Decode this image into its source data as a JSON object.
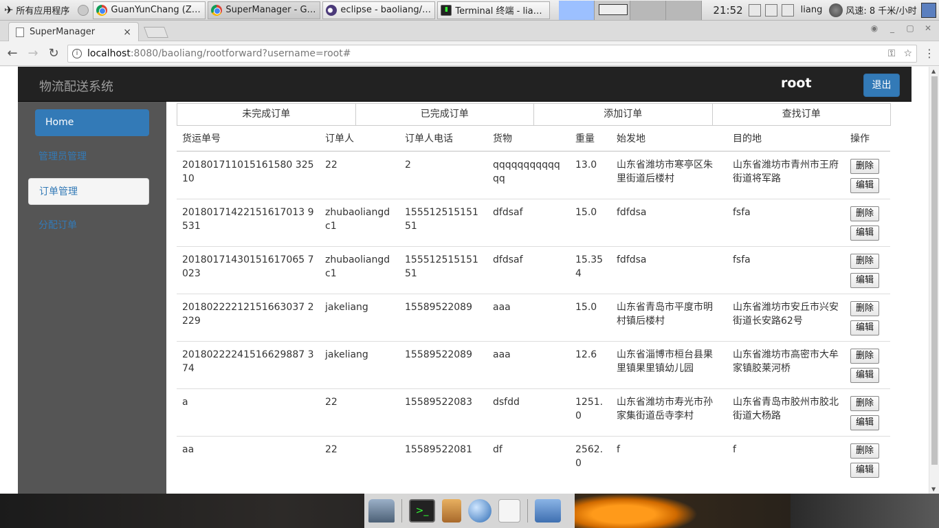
{
  "taskbar": {
    "apps_menu": "所有应用程序",
    "tasks": [
      {
        "icon": "chrome-icon",
        "label": "GuanYunChang (ZhuB…"
      },
      {
        "icon": "chrome-icon",
        "label": "SuperManager - Goog…"
      },
      {
        "icon": "eclipse-icon",
        "label": "eclipse - baoliang/src…"
      },
      {
        "icon": "terminal-icon",
        "label": "Terminal 终端 - liang…"
      }
    ],
    "clock": "21:52",
    "user": "liang",
    "weather": "风速: 8 千米/小时"
  },
  "browser": {
    "tab_title": "SuperManager",
    "tab_close": "×",
    "url_host": "localhost",
    "url_rest": ":8080/baoliang/rootforward?username=root#",
    "window_buttons": [
      "_",
      "▢",
      "✕"
    ]
  },
  "site": {
    "brand": "物流配送系统",
    "username": "root",
    "logout": "退出",
    "sidebar": [
      "Home",
      "管理员管理",
      "订单管理",
      "分配订单"
    ],
    "tabs": [
      "未完成订单",
      "已完成订单",
      "添加订单",
      "查找订单"
    ],
    "columns": [
      "货运单号",
      "订单人",
      "订单人电话",
      "货物",
      "重量",
      "始发地",
      "目的地",
      "操作"
    ],
    "delete_label": "删除",
    "edit_label": "编辑",
    "rows": [
      {
        "id": "201801711015161580 32510",
        "name": "22",
        "phone": "2",
        "goods": "qqqqqqqqqqqqq",
        "weight": "13.0",
        "from": "山东省潍坊市寒亭区朱里街道后楼村",
        "to": "山东省潍坊市青州市王府街道将军路"
      },
      {
        "id": "20180171422151617013 9531",
        "name": "zhubaoliangdc1",
        "phone": "15551251515151",
        "goods": "dfdsaf",
        "weight": "15.0",
        "from": "fdfdsa",
        "to": "fsfa"
      },
      {
        "id": "20180171430151617065 7023",
        "name": "zhubaoliangdc1",
        "phone": "15551251515151",
        "goods": "dfdsaf",
        "weight": "15.354",
        "from": "fdfdsa",
        "to": "fsfa"
      },
      {
        "id": "20180222212151663037 2229",
        "name": "jakeliang",
        "phone": "15589522089",
        "goods": "aaa",
        "weight": "15.0",
        "from": "山东省青岛市平度市明村镇后楼村",
        "to": "山东省潍坊市安丘市兴安街道长安路62号"
      },
      {
        "id": "20180222241516629887 374",
        "name": "jakeliang",
        "phone": "15589522089",
        "goods": "aaa",
        "weight": "12.6",
        "from": "山东省淄博市桓台县果里镇果里镇幼儿园",
        "to": "山东省潍坊市高密市大牟家镇胶莱河桥"
      },
      {
        "id": "a",
        "name": "22",
        "phone": "15589522083",
        "goods": "dsfdd",
        "weight": "1251.0",
        "from": "山东省潍坊市寿光市孙家集街道岳寺李村",
        "to": "山东省青岛市胶州市胶北街道大杨路"
      },
      {
        "id": "aa",
        "name": "22",
        "phone": "15589522081",
        "goods": "df",
        "weight": "2562.0",
        "from": "f",
        "to": "f"
      }
    ]
  }
}
